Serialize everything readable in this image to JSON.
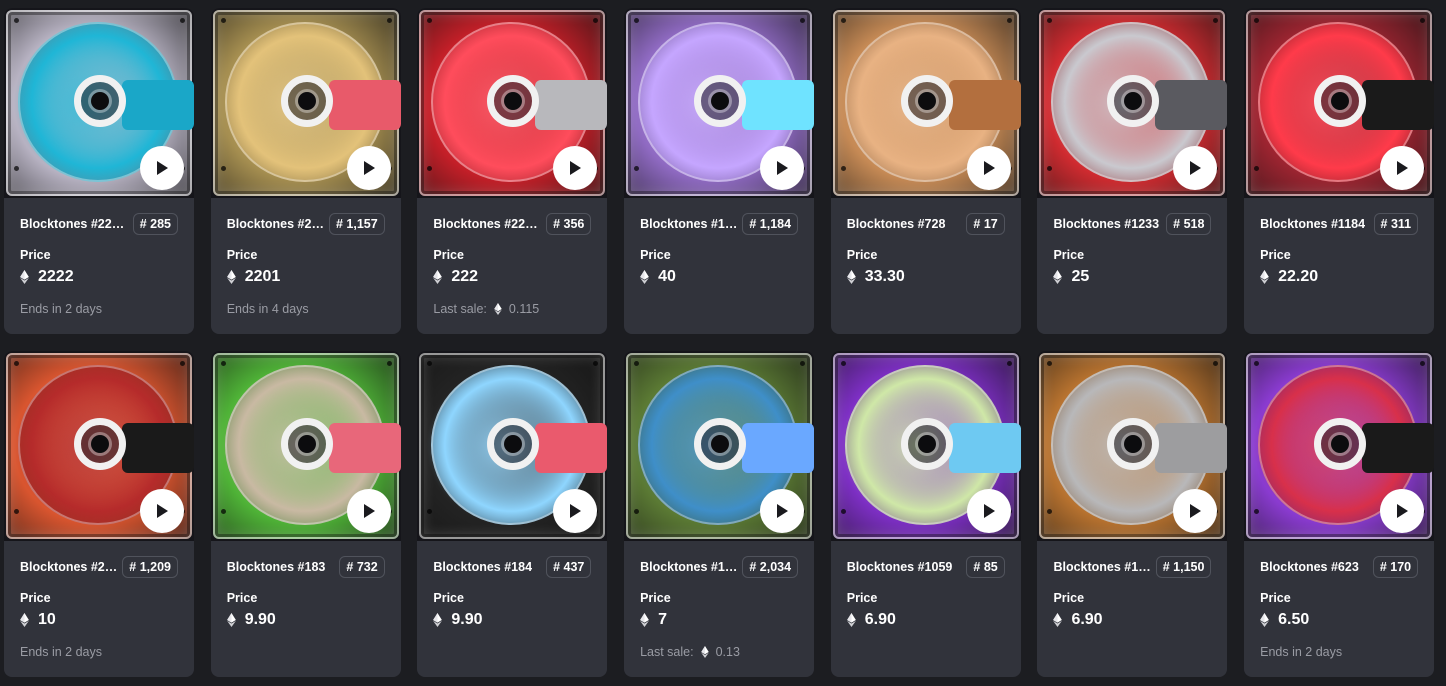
{
  "currency_icon": "ethereum-icon",
  "price_label": "Price",
  "rows": [
    {
      "cards": [
        {
          "title": "Blocktones #22…",
          "rank": "# 285",
          "price": "2222",
          "note_type": "ends",
          "note": "Ends in 2 days",
          "art": {
            "bg": "#b7b2c2",
            "accent": "#1fb6d6",
            "label": "#1aa7c8"
          }
        },
        {
          "title": "Blocktones #2…",
          "rank": "# 1,157",
          "price": "2201",
          "note_type": "ends",
          "note": "Ends in 4 days",
          "art": {
            "bg": "#a58e50",
            "accent": "#e3c27a",
            "label": "#e85a6a"
          }
        },
        {
          "title": "Blocktones #22…",
          "rank": "# 356",
          "price": "222",
          "note_type": "sale",
          "note": "Last sale:",
          "note_value": "0.115",
          "art": {
            "bg": "#c41f28",
            "accent": "#ff4d5c",
            "label": "#b8b8bc"
          }
        },
        {
          "title": "Blocktones #17…",
          "rank": "# 1,184",
          "price": "40",
          "note_type": "none",
          "note": "",
          "art": {
            "bg": "#8f6ac2",
            "accent": "#c5a6ff",
            "label": "#6fe3ff"
          }
        },
        {
          "title": "Blocktones #728",
          "rank": "# 17",
          "price": "33.30",
          "note_type": "none",
          "note": "",
          "art": {
            "bg": "#c68a55",
            "accent": "#e8b283",
            "label": "#b36f3e"
          }
        },
        {
          "title": "Blocktones #1233",
          "rank": "# 518",
          "price": "25",
          "note_type": "none",
          "note": "",
          "art": {
            "bg": "#d02b30",
            "accent": "#c9c9cf",
            "label": "#5a5a60"
          }
        },
        {
          "title": "Blocktones #1184",
          "rank": "# 311",
          "price": "22.20",
          "note_type": "none",
          "note": "",
          "art": {
            "bg": "#9b2430",
            "accent": "#ff3b4a",
            "label": "#1a1a1a"
          }
        }
      ]
    },
    {
      "cards": [
        {
          "title": "Blocktones #2…",
          "rank": "# 1,209",
          "price": "10",
          "note_type": "ends",
          "note": "Ends in 2 days",
          "art": {
            "bg": "#d9552f",
            "accent": "#b52b2b",
            "label": "#1a1a1a"
          }
        },
        {
          "title": "Blocktones #183",
          "rank": "# 732",
          "price": "9.90",
          "note_type": "none",
          "note": "",
          "art": {
            "bg": "#4fb337",
            "accent": "#c9b9a3",
            "label": "#e8677a"
          }
        },
        {
          "title": "Blocktones #184",
          "rank": "# 437",
          "price": "9.90",
          "note_type": "none",
          "note": "",
          "art": {
            "bg": "#232323",
            "accent": "#8fd6ff",
            "label": "#ea5a6d"
          }
        },
        {
          "title": "Blocktones #1…",
          "rank": "# 2,034",
          "price": "7",
          "note_type": "sale",
          "note": "Last sale:",
          "note_value": "0.13",
          "art": {
            "bg": "#5b7a34",
            "accent": "#3f8fc9",
            "label": "#6aa8ff"
          }
        },
        {
          "title": "Blocktones #1059",
          "rank": "# 85",
          "price": "6.90",
          "note_type": "none",
          "note": "",
          "art": {
            "bg": "#7d2fc4",
            "accent": "#cfe8a7",
            "label": "#6ec9f2"
          }
        },
        {
          "title": "Blocktones #1…",
          "rank": "# 1,150",
          "price": "6.90",
          "note_type": "none",
          "note": "",
          "art": {
            "bg": "#b7722f",
            "accent": "#b8b8ba",
            "label": "#9d9d9f"
          }
        },
        {
          "title": "Blocktones #623",
          "rank": "# 170",
          "price": "6.50",
          "note_type": "ends",
          "note": "Ends in 2 days",
          "art": {
            "bg": "#8a3bd0",
            "accent": "#d8304a",
            "label": "#1a1a1a"
          }
        }
      ]
    }
  ]
}
